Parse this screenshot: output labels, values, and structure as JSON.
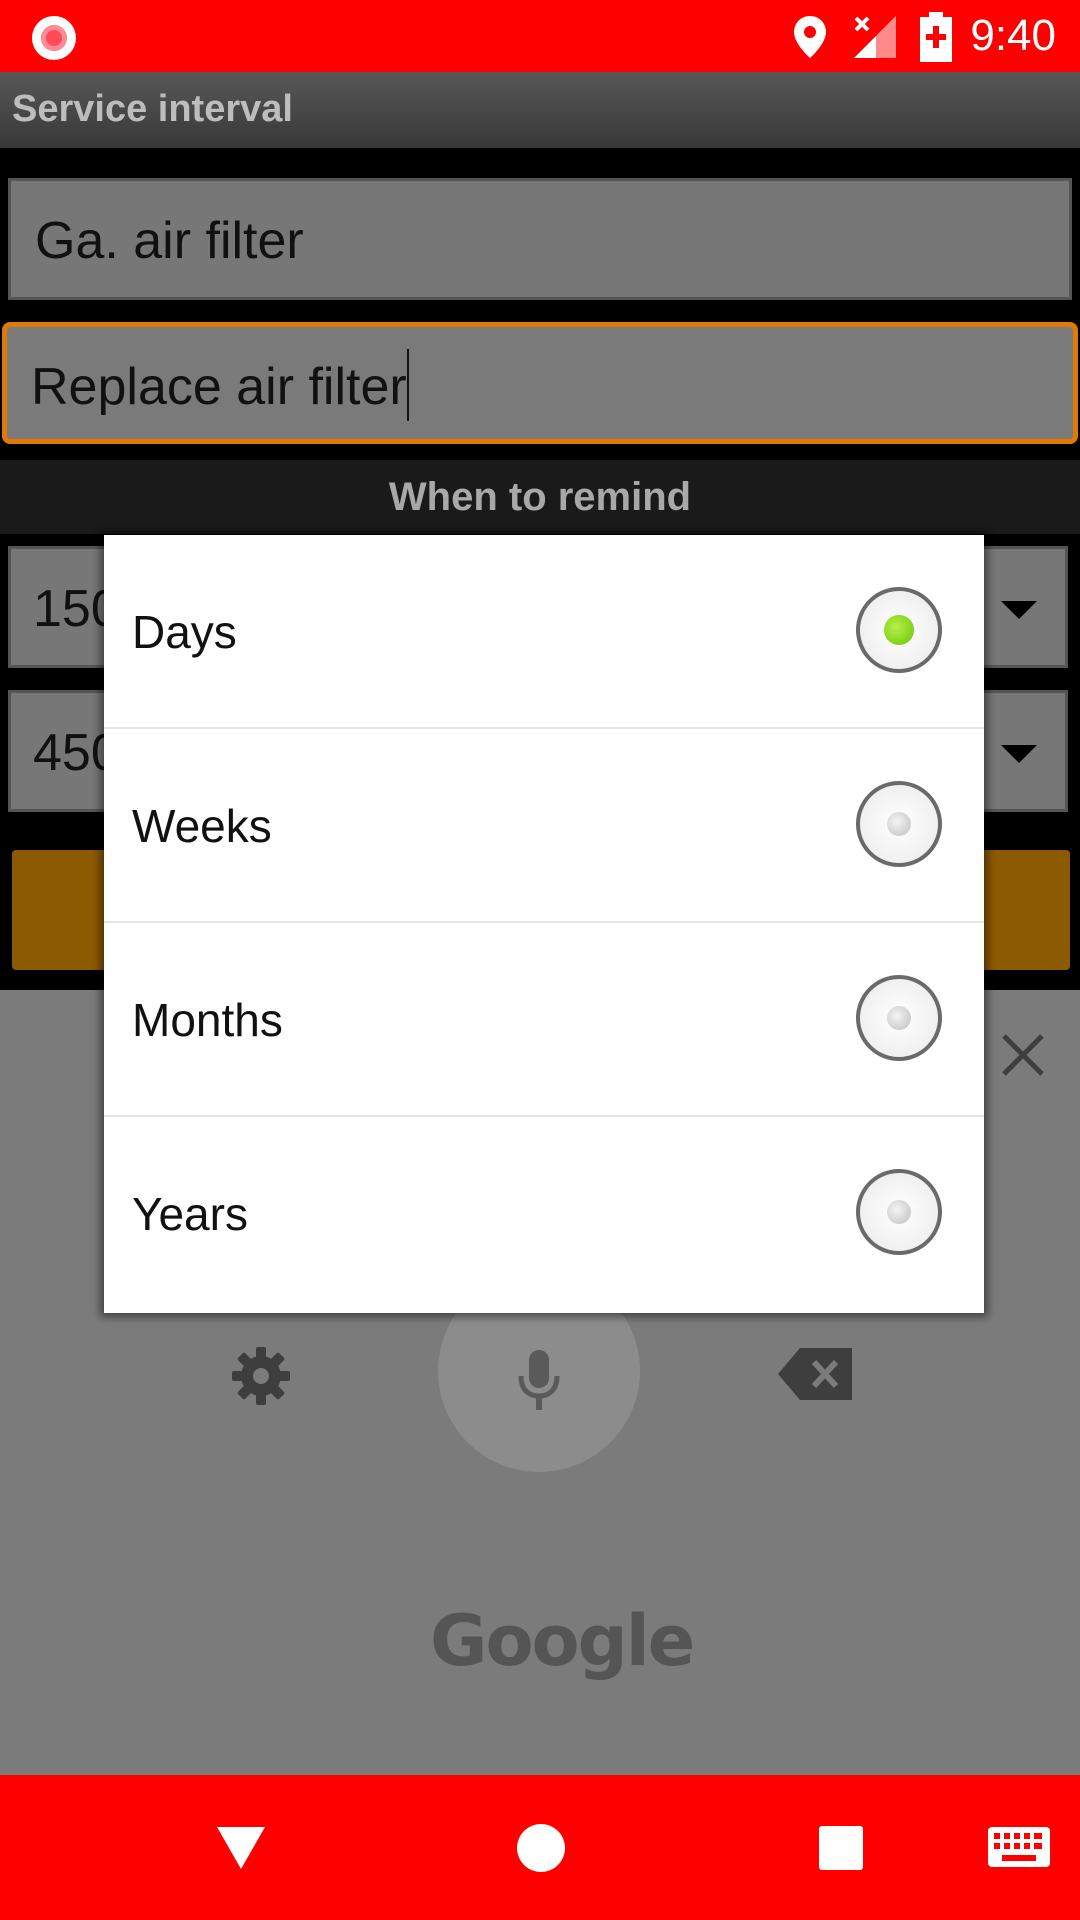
{
  "status_bar": {
    "time": "9:40",
    "icons": [
      "record-icon",
      "location-icon",
      "no-signal-icon",
      "battery-charging-icon"
    ]
  },
  "app_bar": {
    "title": "Service interval"
  },
  "form": {
    "name_value": "Ga. air filter",
    "description_value": "Replace air filter",
    "section_header": "When to remind",
    "interval_1_value": "150",
    "interval_2_value": "450",
    "accent_color": "#e07a00"
  },
  "dialog": {
    "options": [
      {
        "label": "Days",
        "checked": true
      },
      {
        "label": "Weeks",
        "checked": false
      },
      {
        "label": "Months",
        "checked": false
      },
      {
        "label": "Years",
        "checked": false
      }
    ],
    "checked_color": "#7ed321"
  },
  "keyboard": {
    "logo_text": "Google",
    "icons": [
      "close-icon",
      "gear-icon",
      "mic-icon",
      "backspace-icon"
    ]
  },
  "nav_bar": {
    "icons": [
      "back-icon",
      "home-icon",
      "recents-icon",
      "keyboard-icon"
    ],
    "color": "#ff0000"
  }
}
